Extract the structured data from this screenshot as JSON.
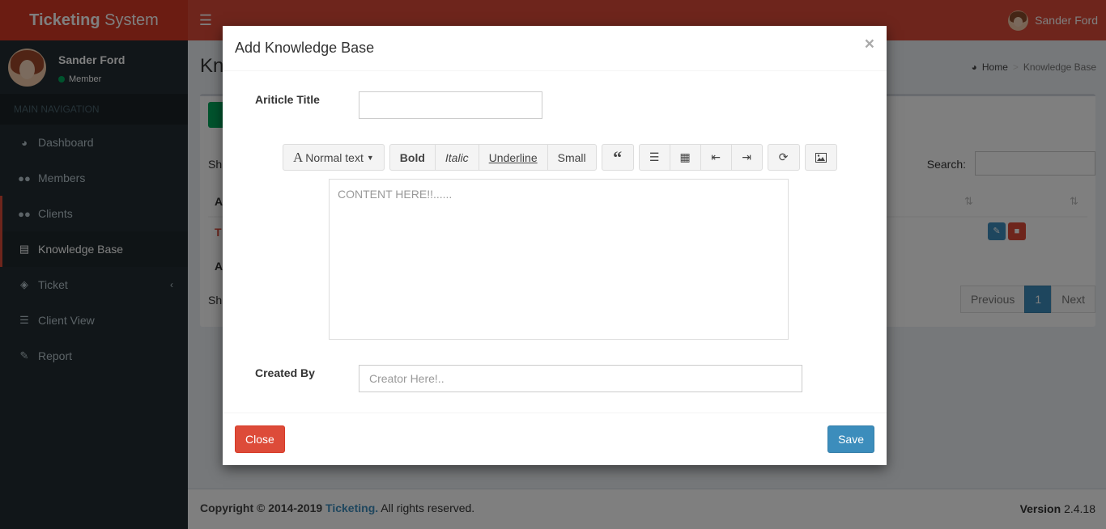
{
  "header": {
    "logo_bold": "Ticketing",
    "logo_rest": " System",
    "user_name": "Sander Ford"
  },
  "sidebar": {
    "user_name": "Sander Ford",
    "user_status": "Member",
    "nav_header": "MAIN NAVIGATION",
    "items": [
      {
        "label": "Dashboard",
        "icon": "dashboard-icon"
      },
      {
        "label": "Members",
        "icon": "users-icon"
      },
      {
        "label": "Clients",
        "icon": "users-icon"
      },
      {
        "label": "Knowledge Base",
        "icon": "book-icon",
        "active": true
      },
      {
        "label": "Ticket",
        "icon": "ticket-icon",
        "has_children": true
      },
      {
        "label": "Client View",
        "icon": "list-icon"
      },
      {
        "label": "Report",
        "icon": "edit-icon"
      }
    ]
  },
  "content": {
    "title": "Kn",
    "breadcrumb": {
      "home": "Home",
      "current": "Knowledge Base"
    },
    "show_label": "Sh",
    "search_label": "Search:",
    "row_link": "T",
    "foot_col": "A",
    "head_col": "A",
    "show_label2": "Sh",
    "pagination": {
      "previous": "Previous",
      "current": "1",
      "next": "Next"
    }
  },
  "footer": {
    "copyright_prefix": "Copyright © 2014-2019 ",
    "brand": "Ticketing.",
    "copyright_suffix": " All rights reserved.",
    "version_label": "Version",
    "version": "2.4.18"
  },
  "modal": {
    "title": "Add Knowledge Base",
    "close_glyph": "×",
    "article_title_label": "Ariticle Title",
    "article_title_value": "",
    "toolbar": {
      "text_style": "Normal text",
      "bold": "Bold",
      "italic": "Italic",
      "underline": "Underline",
      "small": "Small"
    },
    "editor_placeholder": "CONTENT HERE!!......",
    "created_by_label": "Created By",
    "created_by_placeholder": "Creator Here!..",
    "close_button": "Close",
    "save_button": "Save"
  }
}
